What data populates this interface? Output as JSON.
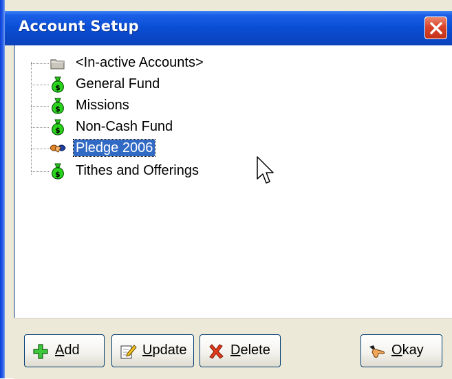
{
  "window": {
    "title": "Account Setup",
    "titlebar_color": "#0a4fd6",
    "close_icon": "close-x-icon"
  },
  "tree": {
    "items": [
      {
        "label": "<In-active Accounts>",
        "icon": "folder-icon",
        "selected": false
      },
      {
        "label": "General Fund",
        "icon": "money-bag-icon",
        "selected": false
      },
      {
        "label": "Missions",
        "icon": "money-bag-icon",
        "selected": false
      },
      {
        "label": "Non-Cash Fund",
        "icon": "money-bag-icon",
        "selected": false
      },
      {
        "label": "Pledge 2006",
        "icon": "handshake-icon",
        "selected": true
      },
      {
        "label": "Tithes and Offerings",
        "icon": "money-bag-icon",
        "selected": false
      }
    ],
    "selection_color": "#316ac5"
  },
  "buttons": {
    "add": {
      "mnemonic": "A",
      "rest": "dd",
      "icon": "green-plus-icon"
    },
    "update": {
      "mnemonic": "U",
      "rest": "pdate",
      "icon": "edit-pencil-icon"
    },
    "delete": {
      "mnemonic": "D",
      "rest": "elete",
      "icon": "red-x-icon"
    },
    "okay": {
      "mnemonic": "O",
      "rest": "kay",
      "icon": "pointing-hand-icon"
    }
  }
}
